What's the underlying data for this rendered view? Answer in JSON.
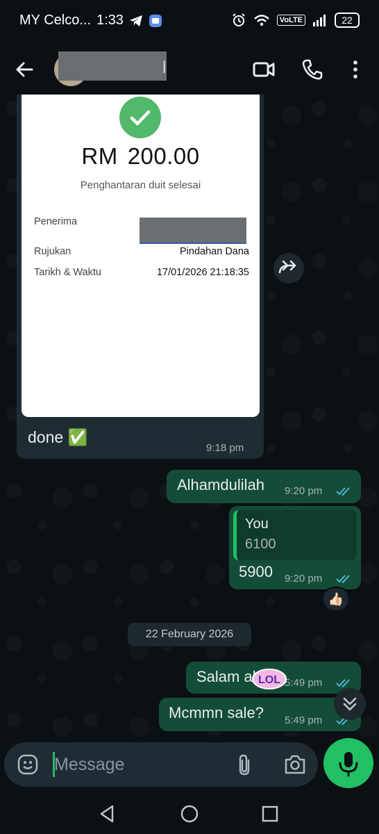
{
  "status_bar": {
    "carrier": "MY Celco...",
    "time": "1:33",
    "network": "VoLTE",
    "battery": "22"
  },
  "header": {
    "contact_name_visible": "l"
  },
  "receipt": {
    "currency": "RM",
    "amount": "200.00",
    "subtitle": "Penghantaran duit selesai",
    "rows": [
      {
        "label": "Penerima",
        "value": ""
      },
      {
        "label": "Rujukan",
        "value": "Pindahan Dana"
      },
      {
        "label": "Tarikh & Waktu",
        "value": "17/01/2026 21:18:35"
      }
    ]
  },
  "messages": [
    {
      "id": "m1",
      "direction": "incoming",
      "text": "done ✅",
      "time": "9:18 pm"
    },
    {
      "id": "m2",
      "direction": "outgoing",
      "text": "Alhamdulilah",
      "time": "9:20 pm"
    },
    {
      "id": "m3",
      "direction": "outgoing",
      "quote_author": "You",
      "quote_text": "6100",
      "text": "5900",
      "time": "9:20 pm",
      "reaction": "👍🏻"
    },
    {
      "id": "m4",
      "direction": "outgoing",
      "text": "Salam al",
      "time": "5:49 pm"
    },
    {
      "id": "m5",
      "direction": "outgoing",
      "text": "Mcmmn sale?",
      "time": "5:49 pm"
    }
  ],
  "sticker_text": "LOL",
  "date_divider": "22 February 2026",
  "composer": {
    "placeholder": "Message"
  },
  "colors": {
    "background": "#0b1014",
    "incoming_bubble": "#202c33",
    "outgoing_bubble": "#144d37",
    "accent": "#21c063",
    "read_ticks": "#53bdeb"
  }
}
